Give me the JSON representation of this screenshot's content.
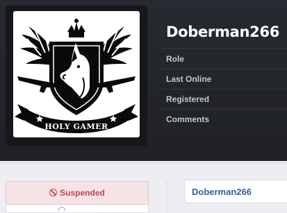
{
  "profile": {
    "username": "Doberman266",
    "avatar_caption": "HOLY GAMER"
  },
  "info": [
    {
      "label": "Role"
    },
    {
      "label": "Last Online"
    },
    {
      "label": "Registered"
    },
    {
      "label": "Comments"
    }
  ],
  "status": {
    "label": "Suspended",
    "icon": "ban-icon",
    "color": "#c0425a"
  },
  "panel": {
    "name_link": "Doberman266"
  },
  "colors": {
    "header_bg": "#272a30",
    "link": "#3c5a9e"
  }
}
